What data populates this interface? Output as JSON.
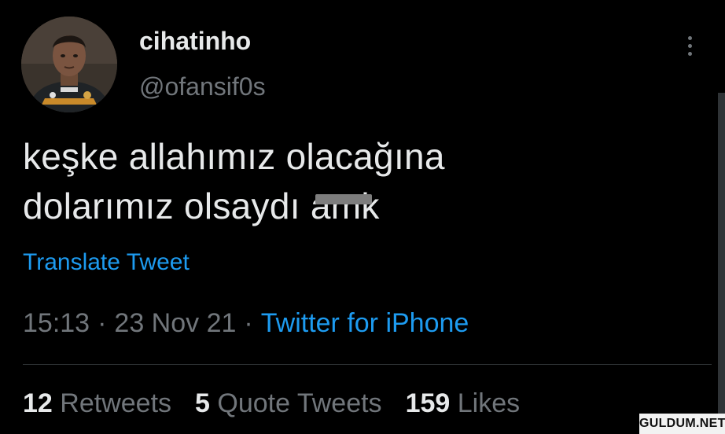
{
  "user": {
    "display_name": "cihatinho",
    "handle": "@ofansif0s"
  },
  "tweet": {
    "line1": "keşke allahımız olacağına",
    "line2_prefix": "dolarımız olsaydı ",
    "line2_censored": "amk"
  },
  "translate_label": "Translate Tweet",
  "meta": {
    "time": "15:13",
    "separator": "·",
    "date": "23 Nov 21",
    "source": "Twitter for iPhone"
  },
  "stats": {
    "retweets_count": "12",
    "retweets_label": "Retweets",
    "quotes_count": "5",
    "quotes_label": "Quote Tweets",
    "likes_count": "159",
    "likes_label": "Likes"
  },
  "watermark": "GULDUM.NET",
  "colors": {
    "background": "#000000",
    "text": "#e7e9ea",
    "muted": "#71767b",
    "accent": "#1d9bf0"
  },
  "icons": {
    "more": "more-vertical-icon"
  }
}
